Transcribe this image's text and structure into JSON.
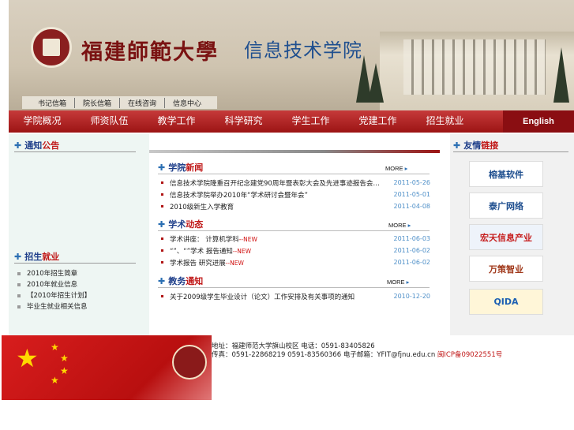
{
  "banner": {
    "title_cn": "福建師範大學",
    "title_dept": "信息技术学院",
    "watermark": "http://cit.fjnu.edu.cn"
  },
  "topnav": [
    "书记信箱",
    "院长信箱",
    "在线咨询",
    "信息中心"
  ],
  "mainnav": {
    "items": [
      "学院概况",
      "师资队伍",
      "教学工作",
      "科学研究",
      "学生工作",
      "党建工作",
      "招生就业"
    ],
    "english": "English"
  },
  "left": {
    "sec1": {
      "a": "通知",
      "b": "公告"
    },
    "sec2": {
      "a": "招生",
      "b": "就业"
    },
    "list": [
      "2010年招生简章",
      "2010年就业信息",
      "【2010年招生计划】",
      "毕业生就业相关信息"
    ]
  },
  "mid": {
    "sec1": {
      "a": "学院",
      "b": "新闻"
    },
    "sec2": {
      "a": "学术",
      "b": "动态"
    },
    "sec3": {
      "a": "教务",
      "b": "通知"
    },
    "more": "MORE",
    "news1": [
      {
        "text": "信息技术学院隆重召开纪念建党90周年暨表彰大会及先进事迹报告会…",
        "date": "2011-05-26"
      },
      {
        "text": "信息技术学院举办2010年“学术研讨会暨年会”",
        "date": "2011-05-01"
      },
      {
        "text": "2010级新生入学教育",
        "date": "2011-04-08"
      }
    ],
    "news2": [
      {
        "text": "学术讲座：      计算机学科",
        "new": "--NEW",
        "date": "2011-06-03"
      },
      {
        "text": "“”、“”学术      报告通知",
        "new": "--NEW",
        "date": "2011-06-02"
      },
      {
        "text": "学术报告      研究进展",
        "new": "--NEW",
        "date": "2011-06-02"
      }
    ],
    "news3": [
      {
        "text": "关于2009级学生毕业设计（论文）工作安排及有关事项的通知",
        "date": "2010-12-20"
      }
    ]
  },
  "right": {
    "sec": {
      "a": "友情",
      "b": "链接"
    },
    "links": [
      "榕基软件",
      "泰广网络",
      "宏天信息产业",
      "万策智业",
      "QIDA"
    ]
  },
  "footer": {
    "line1": "地址：福建师范大学旗山校区  电话：0591-83405826",
    "line2_a": "传真：0591-22868219 0591-83560366 电子邮箱：YFIT@fjnu.edu.cn ",
    "line2_b": "闽ICP备09022551号"
  },
  "colors": {
    "accent": "#9c1414",
    "nav_blue": "#1f3f8a",
    "date": "#4e8fc8"
  }
}
